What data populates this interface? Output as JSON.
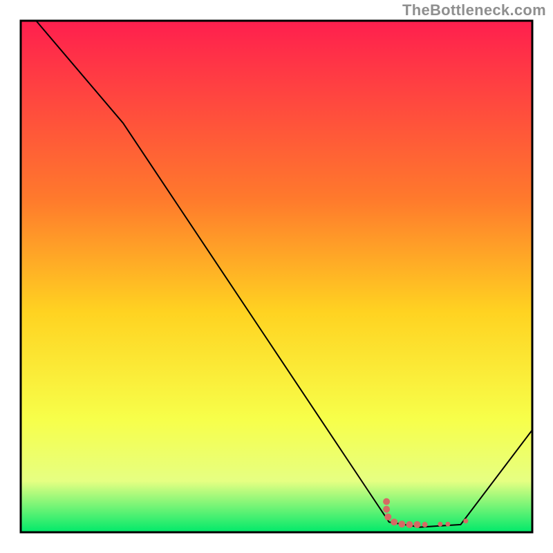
{
  "attribution": "TheBottleneck.com",
  "colors": {
    "gradient_top": "#ff1f4e",
    "gradient_mid1": "#ff7a2c",
    "gradient_mid2": "#ffd321",
    "gradient_mid3": "#f7ff4a",
    "gradient_mid4": "#e6ff82",
    "gradient_bottom": "#00e96a",
    "curve": "#000000",
    "marker": "#d56a64",
    "frame": "#000000"
  },
  "chart_data": {
    "type": "line",
    "title": "",
    "xlabel": "",
    "ylabel": "",
    "xlim": [
      0,
      100
    ],
    "ylim": [
      0,
      100
    ],
    "grid": false,
    "curve": [
      {
        "x": 3,
        "y": 100
      },
      {
        "x": 20,
        "y": 80
      },
      {
        "x": 70,
        "y": 5
      },
      {
        "x": 72,
        "y": 2
      },
      {
        "x": 78,
        "y": 1
      },
      {
        "x": 86,
        "y": 1.5
      },
      {
        "x": 100,
        "y": 20
      }
    ],
    "markers": [
      {
        "x": 71.5,
        "y": 6.0,
        "r": 5.0
      },
      {
        "x": 71.5,
        "y": 4.5,
        "r": 5.0
      },
      {
        "x": 71.8,
        "y": 3.0,
        "r": 5.0
      },
      {
        "x": 73.0,
        "y": 2.0,
        "r": 5.0
      },
      {
        "x": 74.5,
        "y": 1.6,
        "r": 5.0
      },
      {
        "x": 76.0,
        "y": 1.5,
        "r": 5.0
      },
      {
        "x": 77.5,
        "y": 1.5,
        "r": 5.0
      },
      {
        "x": 79.0,
        "y": 1.5,
        "r": 4.0
      },
      {
        "x": 82.0,
        "y": 1.6,
        "r": 3.5
      },
      {
        "x": 83.5,
        "y": 1.6,
        "r": 3.5
      },
      {
        "x": 87.0,
        "y": 2.2,
        "r": 3.5
      }
    ],
    "comment": "Axes carry no visible tick labels; x and y are normalized 0–100 relative to the framed plot area. The curve shows bottleneck percentage descending from top-left, bottoming near x≈78–86, then rising at the right edge. Markers cluster along the trough."
  }
}
